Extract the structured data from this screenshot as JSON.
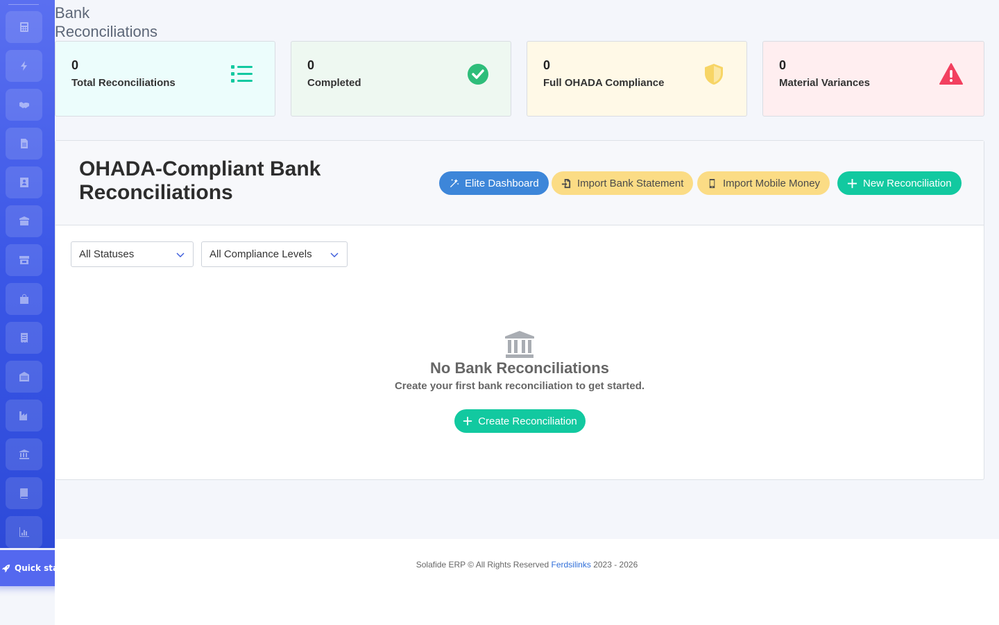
{
  "page": {
    "title": "Bank Reconciliations"
  },
  "sidebar": {
    "items": [
      {
        "icon": "calculator-icon"
      },
      {
        "icon": "bolt-icon"
      },
      {
        "icon": "handshake-icon"
      },
      {
        "icon": "document-icon"
      },
      {
        "icon": "contact-icon"
      },
      {
        "icon": "boxes-icon"
      },
      {
        "icon": "store-icon"
      },
      {
        "icon": "shopping-bag-icon"
      },
      {
        "icon": "receipt-icon"
      },
      {
        "icon": "warehouse-icon"
      },
      {
        "icon": "industry-icon"
      },
      {
        "icon": "bank-icon"
      },
      {
        "icon": "book-icon"
      },
      {
        "icon": "chart-icon"
      }
    ]
  },
  "quick_start": {
    "label": "Quick start"
  },
  "stats": [
    {
      "value": "0",
      "label": "Total Reconciliations",
      "bg": "#ecfdfc",
      "icon": "list-icon",
      "icon_color": "#12c9a0"
    },
    {
      "value": "0",
      "label": "Completed",
      "bg": "#eef8f1",
      "icon": "check-circle-icon",
      "icon_color": "#2ebd7a"
    },
    {
      "value": "0",
      "label": "Full OHADA Compliance",
      "bg": "#fff9e7",
      "icon": "shield-icon",
      "icon_color": "#f7d565"
    },
    {
      "value": "0",
      "label": "Material Variances",
      "bg": "#ffeef0",
      "icon": "warning-icon",
      "icon_color": "#f2405f"
    }
  ],
  "panel": {
    "title": "OHADA-Compliant Bank Reconciliations",
    "buttons": {
      "elite_dashboard": "Elite Dashboard",
      "import_bank_statement": "Import Bank Statement",
      "import_mobile_money": "Import Mobile Money",
      "new_reconciliation": "New Reconciliation"
    },
    "filters": {
      "status": "All Statuses",
      "compliance": "All Compliance Levels"
    },
    "empty": {
      "title": "No Bank Reconciliations",
      "subtitle": "Create your first bank reconciliation to get started.",
      "button": "Create Reconciliation"
    }
  },
  "footer": {
    "prefix": "Solafide ERP © All Rights Reserved",
    "link": "Ferdsilinks",
    "years": "2023 - 2026"
  }
}
